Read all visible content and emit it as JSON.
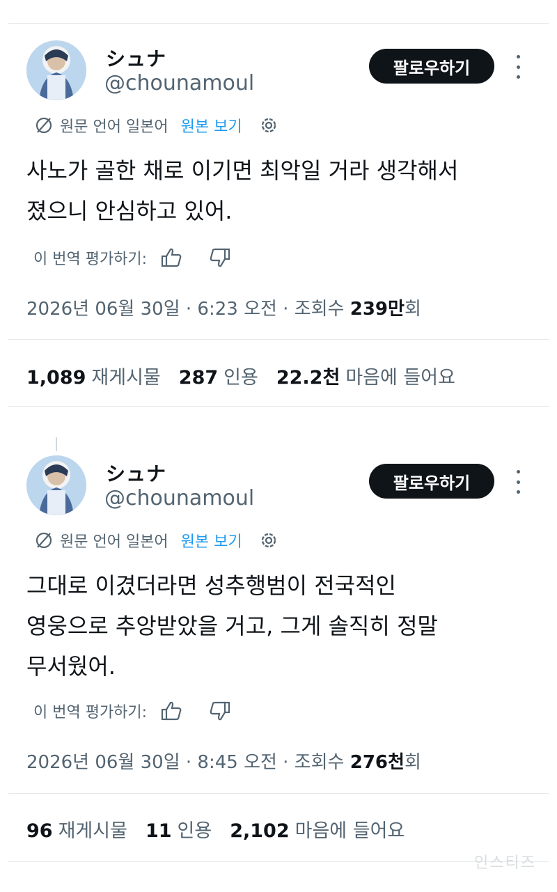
{
  "posts": [
    {
      "display_name": "シュナ",
      "handle": "@chounamoul",
      "follow_label": "팔로우하기",
      "translation_source": "원문 언어 일본어",
      "view_original_label": "원본 보기",
      "body_lines": [
        "사노가 골한 채로 이기면 최악일 거라 생각해서",
        "졌으니 안심하고 있어."
      ],
      "rate_label": "이 번역 평가하기:",
      "timestamp": "2026년 06월 30일 · 6:23 오전 · 조회수",
      "views": "239만",
      "views_suffix": "회",
      "reposts": "1,089",
      "reposts_label": "재게시물",
      "quotes": "287",
      "quotes_label": "인용",
      "likes": "22.2천",
      "likes_label": "마음에 들어요"
    },
    {
      "display_name": "シュナ",
      "handle": "@chounamoul",
      "follow_label": "팔로우하기",
      "translation_source": "원문 언어 일본어",
      "view_original_label": "원본 보기",
      "body_lines": [
        "그대로 이겼더라면 성추행범이 전국적인",
        "영웅으로 추앙받았을 거고, 그게 솔직히 정말",
        "무서웠어."
      ],
      "rate_label": "이 번역 평가하기:",
      "timestamp": "2026년 06월 30일 · 8:45 오전 · 조회수",
      "views": "276천",
      "views_suffix": "회",
      "reposts": "96",
      "reposts_label": "재게시물",
      "quotes": "11",
      "quotes_label": "인용",
      "likes": "2,102",
      "likes_label": "마음에 들어요"
    }
  ],
  "watermark": "인스티즈",
  "colors": {
    "accent": "#1d9bf0",
    "text": "#0f1419",
    "muted": "#536471",
    "button": "#0f1419"
  }
}
